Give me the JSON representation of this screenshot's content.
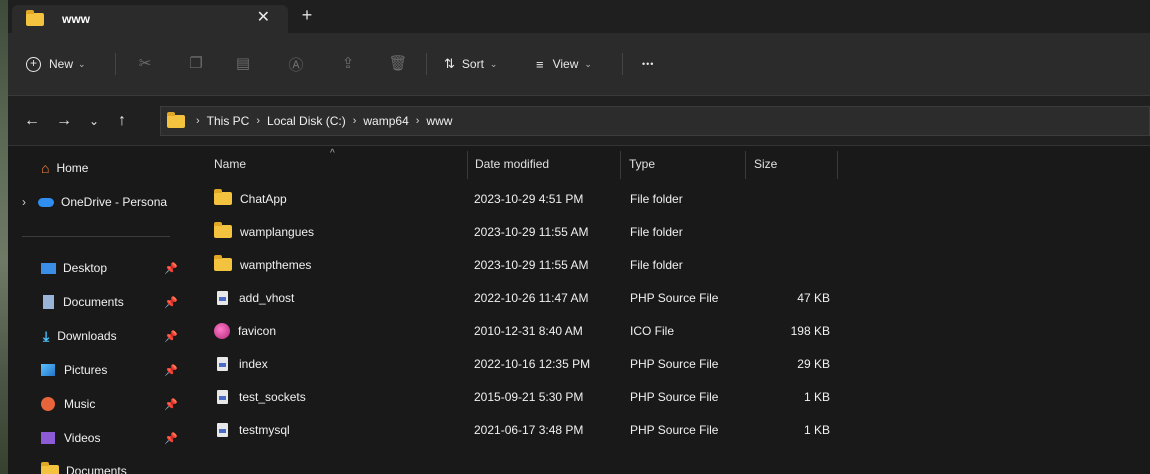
{
  "tab": {
    "title": "www",
    "close_icon": "close-icon",
    "new_tab": "+"
  },
  "toolbar": {
    "new_label": "New",
    "sort_label": "Sort",
    "view_label": "View",
    "more_label": "•••"
  },
  "breadcrumbs": [
    "This PC",
    "Local Disk (C:)",
    "wamp64",
    "www"
  ],
  "sidebar": {
    "home": "Home",
    "onedrive": "OneDrive - Persona",
    "items": [
      {
        "label": "Desktop",
        "icon": "desktop-icon",
        "color": "#3a8ee6"
      },
      {
        "label": "Documents",
        "icon": "documents-icon",
        "color": "#9ab4d8"
      },
      {
        "label": "Downloads",
        "icon": "downloads-icon",
        "color": "#4cc2ff"
      },
      {
        "label": "Pictures",
        "icon": "pictures-icon",
        "color": "#38a7e8"
      },
      {
        "label": "Music",
        "icon": "music-icon",
        "color": "#e8643a"
      },
      {
        "label": "Videos",
        "icon": "videos-icon",
        "color": "#8e5bd6"
      }
    ],
    "partial_item": "Documents"
  },
  "columns": {
    "name": "Name",
    "date": "Date modified",
    "type": "Type",
    "size": "Size"
  },
  "files": [
    {
      "name": "ChatApp",
      "date": "2023-10-29 4:51 PM",
      "type": "File folder",
      "size": "",
      "kind": "folder"
    },
    {
      "name": "wamplangues",
      "date": "2023-10-29 11:55 AM",
      "type": "File folder",
      "size": "",
      "kind": "folder"
    },
    {
      "name": "wampthemes",
      "date": "2023-10-29 11:55 AM",
      "type": "File folder",
      "size": "",
      "kind": "folder"
    },
    {
      "name": "add_vhost",
      "date": "2022-10-26 11:47 AM",
      "type": "PHP Source File",
      "size": "47 KB",
      "kind": "php"
    },
    {
      "name": "favicon",
      "date": "2010-12-31 8:40 AM",
      "type": "ICO File",
      "size": "198 KB",
      "kind": "ico"
    },
    {
      "name": "index",
      "date": "2022-10-16 12:35 PM",
      "type": "PHP Source File",
      "size": "29 KB",
      "kind": "php"
    },
    {
      "name": "test_sockets",
      "date": "2015-09-21 5:30 PM",
      "type": "PHP Source File",
      "size": "1 KB",
      "kind": "php"
    },
    {
      "name": "testmysql",
      "date": "2021-06-17 3:48 PM",
      "type": "PHP Source File",
      "size": "1 KB",
      "kind": "php"
    }
  ]
}
